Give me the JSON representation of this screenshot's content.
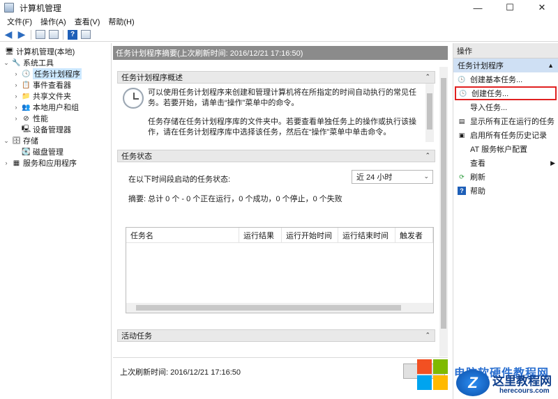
{
  "window": {
    "title": "计算机管理",
    "controls": {
      "minimize": "—",
      "maximize": "☐",
      "close": "✕"
    }
  },
  "menubar": [
    "文件(F)",
    "操作(A)",
    "查看(V)",
    "帮助(H)"
  ],
  "tree": {
    "root": "计算机管理(本地)",
    "system_tools": "系统工具",
    "task_scheduler": "任务计划程序",
    "event_viewer": "事件查看器",
    "shared_folders": "共享文件夹",
    "local_users": "本地用户和组",
    "performance": "性能",
    "device_manager": "设备管理器",
    "storage": "存储",
    "disk_management": "磁盘管理",
    "services_apps": "服务和应用程序"
  },
  "center": {
    "header": "任务计划程序摘要(上次刷新时间: 2016/12/21 17:16:50)",
    "overview_title": "任务计划程序概述",
    "overview_p1": "可以使用任务计划程序来创建和管理计算机将在所指定的时间自动执行的常见任务。若要开始，请单击“操作”菜单中的命令。",
    "overview_p2": "任务存储在任务计划程序库的文件夹中。若要查看单独任务上的操作或执行该操作，请在任务计划程序库中选择该任务，然后在“操作”菜单中单击命令。",
    "status_title": "任务状态",
    "status_label": "在以下时间段启动的任务状态:",
    "status_range": "近 24 小时",
    "summary": "摘要: 总计 0 个 - 0 个正在运行，0 个成功，0 个停止，0 个失败",
    "columns": [
      "任务名",
      "运行结果",
      "运行开始时间",
      "运行结束时间",
      "触发者"
    ],
    "active_title": "活动任务",
    "footer": "上次刷新时间: 2016/12/21 17:16:50"
  },
  "actions": {
    "title": "操作",
    "group": "任务计划程序",
    "items": [
      "创建基本任务...",
      "创建任务...",
      "导入任务...",
      "显示所有正在运行的任务",
      "启用所有任务历史记录",
      "AT 服务帐户配置",
      "查看",
      "刷新",
      "帮助"
    ]
  },
  "watermark": {
    "banner": "电脑软硬件教程网",
    "site": "这里教程网",
    "url": "herecours.com"
  },
  "colors": {
    "highlight_border": "#e02020",
    "header_bar": "#8b8b8b",
    "action_group": "#cfe0f4"
  }
}
